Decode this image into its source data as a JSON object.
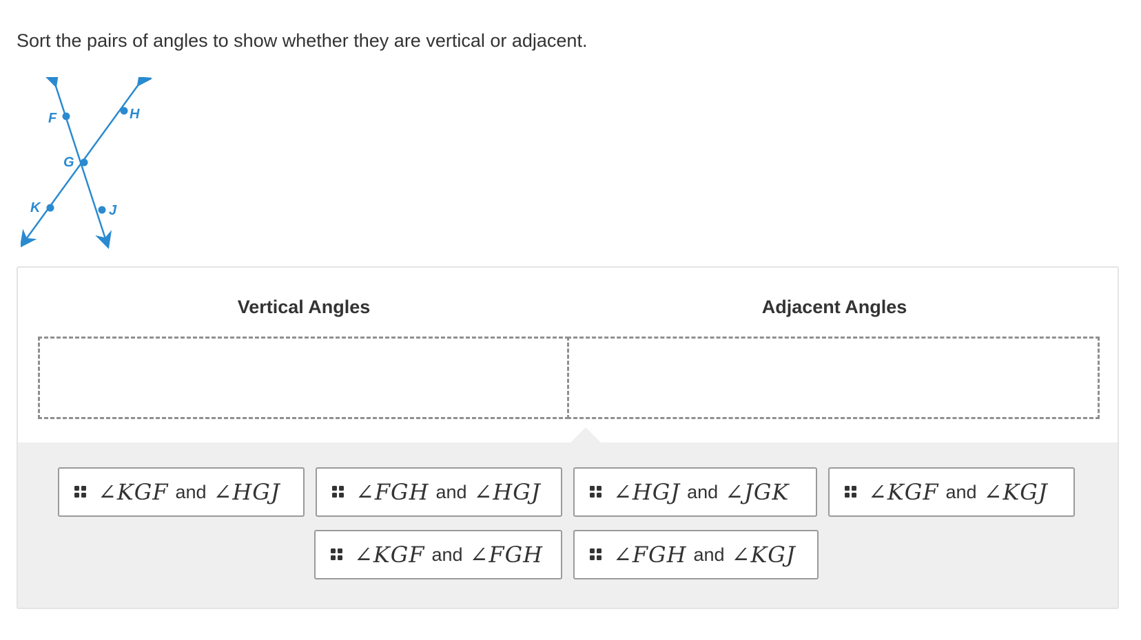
{
  "prompt": "Sort the pairs of angles to show whether they are vertical or adjacent.",
  "figure": {
    "point_labels": [
      "F",
      "H",
      "G",
      "K",
      "J"
    ],
    "line_color": "#2a8ad0"
  },
  "categories": {
    "vertical_label": "Vertical Angles",
    "adjacent_label": "Adjacent Angles"
  },
  "chips": [
    {
      "a": "∠KGF",
      "conj": "and",
      "b": "∠HGJ"
    },
    {
      "a": "∠FGH",
      "conj": "and",
      "b": "∠HGJ"
    },
    {
      "a": "∠HGJ",
      "conj": "and",
      "b": "∠JGK"
    },
    {
      "a": "∠KGF",
      "conj": "and",
      "b": "∠KGJ"
    },
    {
      "a": "∠KGF",
      "conj": "and",
      "b": "∠FGH"
    },
    {
      "a": "∠FGH",
      "conj": "and",
      "b": "∠KGJ"
    }
  ],
  "icons": {
    "chip_handle": "drag-grip-icon"
  }
}
